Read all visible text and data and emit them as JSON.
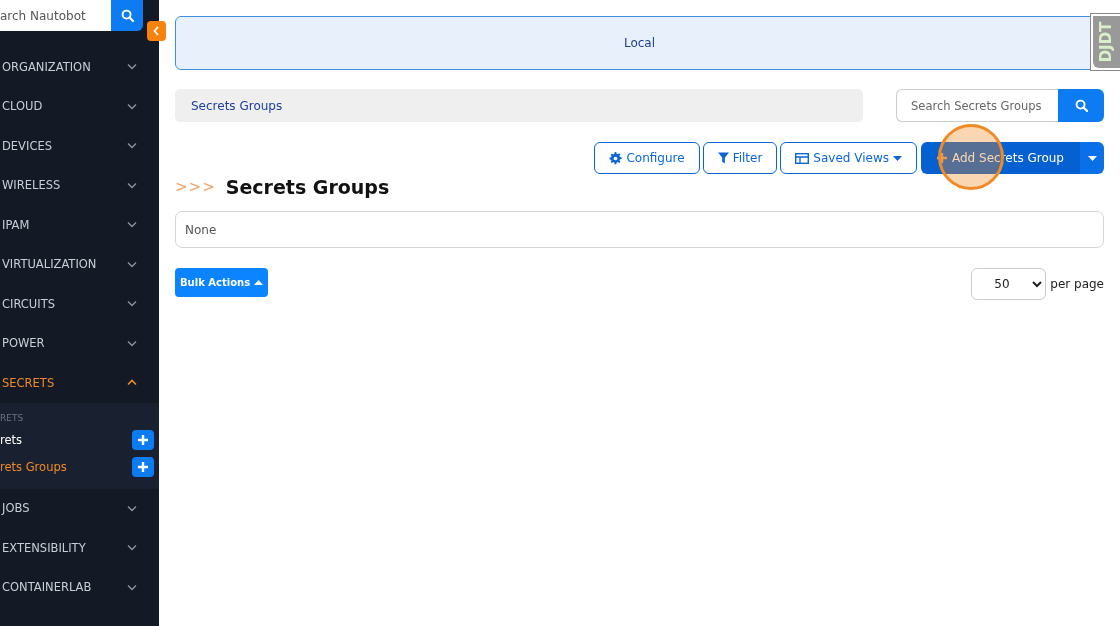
{
  "sidebar": {
    "search": {
      "placeholder": "arch Nautobot"
    },
    "items": [
      {
        "label": "ORGANIZATION",
        "expanded": false,
        "selected": false
      },
      {
        "label": "CLOUD",
        "expanded": false,
        "selected": false
      },
      {
        "label": "DEVICES",
        "expanded": false,
        "selected": false
      },
      {
        "label": "WIRELESS",
        "expanded": false,
        "selected": false
      },
      {
        "label": "IPAM",
        "expanded": false,
        "selected": false
      },
      {
        "label": "VIRTUALIZATION",
        "expanded": false,
        "selected": false
      },
      {
        "label": "CIRCUITS",
        "expanded": false,
        "selected": false
      },
      {
        "label": "POWER",
        "expanded": false,
        "selected": false
      },
      {
        "label": "SECRETS",
        "expanded": true,
        "selected": true,
        "group_header": "RETS",
        "children": [
          {
            "label": "rets",
            "selected": false
          },
          {
            "label": "rets Groups",
            "selected": true
          }
        ]
      },
      {
        "label": "JOBS",
        "expanded": false,
        "selected": false
      },
      {
        "label": "EXTENSIBILITY",
        "expanded": false,
        "selected": false
      },
      {
        "label": "CONTAINERLAB",
        "expanded": false,
        "selected": false
      }
    ]
  },
  "banner": {
    "text": "Local"
  },
  "breadcrumb": [
    "Secrets Groups"
  ],
  "search": {
    "placeholder": "Search Secrets Groups"
  },
  "toolbar": [
    {
      "kind": "configure",
      "label": "Configure",
      "click_marker": false
    },
    {
      "kind": "filter",
      "label": "Filter",
      "click_marker": false
    },
    {
      "kind": "saved_views",
      "label": "Saved Views",
      "click_marker": false
    },
    {
      "kind": "add",
      "label": "Add Secrets Group",
      "click_marker": true
    }
  ],
  "title": {
    "prefix": ">>>",
    "text": "Secrets Groups"
  },
  "filter_summary": "None",
  "bulk_actions": {
    "label": "Bulk Actions"
  },
  "pagination": {
    "value": "50",
    "label": "per page"
  },
  "debug_toolbar": {
    "label": "DJDT"
  }
}
